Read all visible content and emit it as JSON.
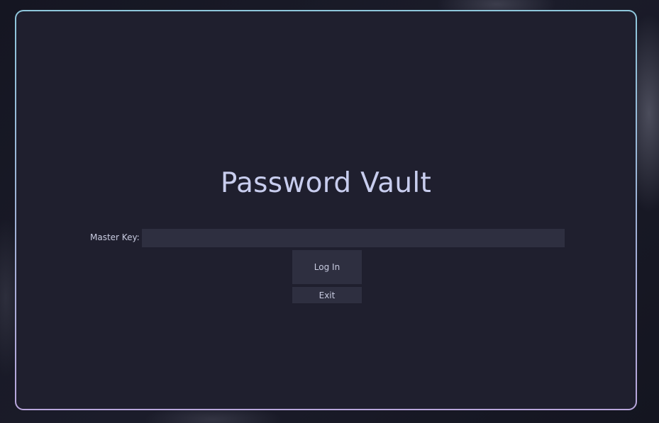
{
  "app": {
    "title": "Password Vault"
  },
  "login_form": {
    "master_key_label": "Master Key:",
    "master_key_value": "",
    "master_key_placeholder": "",
    "login_label": "Log In",
    "exit_label": "Exit"
  },
  "colors": {
    "window_bg": "#1f1f2e",
    "border_gradient": [
      "#8fc7dc",
      "#b9a6dc"
    ],
    "title_text": "#c8cdee",
    "control_bg": "#2e2f40"
  }
}
